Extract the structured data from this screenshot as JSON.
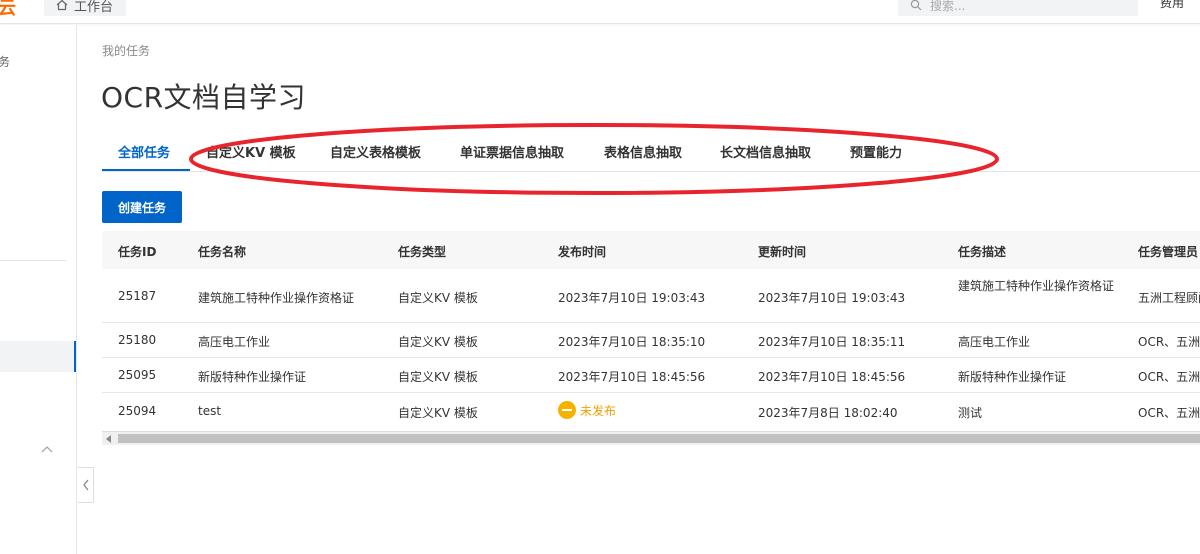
{
  "topbar": {
    "logo_char": "云",
    "workbench_label": "工作台",
    "search_placeholder": "搜索...",
    "fee_label": "费用"
  },
  "sidebar": {
    "fragment_text": "务"
  },
  "breadcrumb": "我的任务",
  "page_title": "OCR文档自学习",
  "tabs": [
    {
      "label": "全部任务",
      "active": true
    },
    {
      "label": "自定义KV 模板"
    },
    {
      "label": "自定义表格模板"
    },
    {
      "label": "单证票据信息抽取"
    },
    {
      "label": "表格信息抽取"
    },
    {
      "label": "长文档信息抽取"
    },
    {
      "label": "预置能力"
    }
  ],
  "create_button_label": "创建任务",
  "table": {
    "columns": [
      "任务ID",
      "任务名称",
      "任务类型",
      "发布时间",
      "更新时间",
      "任务描述",
      "任务管理员"
    ],
    "rows": [
      {
        "id": "25187",
        "name": "建筑施工特种作业操作资格证",
        "type": "自定义KV 模板",
        "published": "2023年7月10日 19:03:43",
        "updated": "2023年7月10日 19:03:43",
        "desc": "建筑施工特种作业操作资格证",
        "admin": "五洲工程顾问"
      },
      {
        "id": "25180",
        "name": "高压电工作业",
        "type": "自定义KV 模板",
        "published": "2023年7月10日 18:35:10",
        "updated": "2023年7月10日 18:35:11",
        "desc": "高压电工作业",
        "admin": "OCR、五洲工"
      },
      {
        "id": "25095",
        "name": "新版特种作业操作证",
        "type": "自定义KV 模板",
        "published": "2023年7月10日 18:45:56",
        "updated": "2023年7月10日 18:45:56",
        "desc": "新版特种作业操作证",
        "admin": "OCR、五洲工"
      },
      {
        "id": "25094",
        "name": "test",
        "type": "自定义KV 模板",
        "published_status": "未发布",
        "updated": "2023年7月8日 18:02:40",
        "desc": "测试",
        "admin": "OCR、五洲工"
      }
    ]
  },
  "colors": {
    "accent": "#0064c8",
    "annotation": "#e8242c",
    "status_unpublished": "#f5b300"
  }
}
